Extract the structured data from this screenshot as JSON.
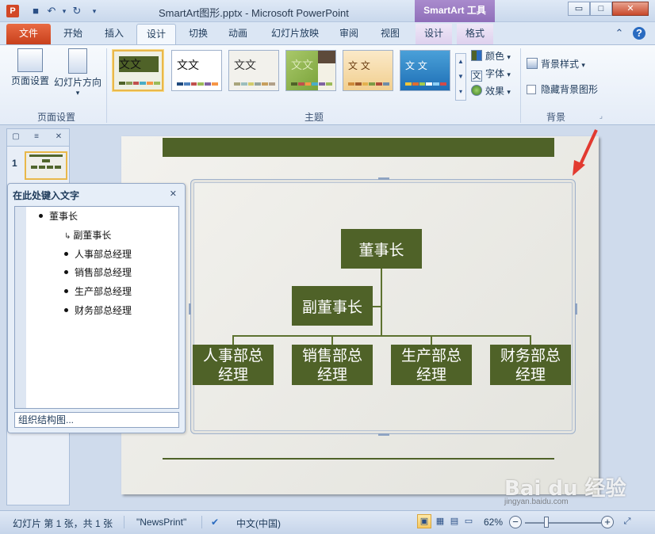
{
  "window": {
    "app_icon_letter": "P",
    "title": "SmartArt图形.pptx  -  Microsoft PowerPoint",
    "contextual_tool_title": "SmartArt 工具",
    "minimize": "▭",
    "restore": "□",
    "close": "✕",
    "qat": {
      "save": "■",
      "undo": "↶",
      "undo_dd": "▾",
      "redo": "↻",
      "customize": "▾"
    }
  },
  "tabs": {
    "file": "文件",
    "home": "开始",
    "insert": "插入",
    "design": "设计",
    "transitions": "切换",
    "animations": "动画",
    "slideshow": "幻灯片放映",
    "review": "审阅",
    "view": "视图",
    "smartart_design": "设计",
    "smartart_format": "格式",
    "help_collapse": "⌃",
    "help": "?"
  },
  "ribbon": {
    "page_setup_label": "页面设置",
    "slide_orientation_label": "幻灯片方向",
    "page_setup_group": "页面设置",
    "themes_group": "主题",
    "theme_sample_text": "文文",
    "theme_sample_text_small": "文 文",
    "colors_label": "颜色",
    "fonts_label": "字体",
    "effects_label": "效果",
    "fonts_icon": "文",
    "bg_styles_label": "背景样式",
    "hide_bg_label": "隐藏背景图形",
    "background_group": "背景",
    "dd": "▾",
    "scroll_up": "▲",
    "scroll_down": "▼",
    "scroll_more": "▾",
    "launcher": "⌟"
  },
  "thumbs": {
    "tab_slides_icon": "▢",
    "tab_outline_icon": "≡",
    "close_icon": "✕",
    "slide_number": "1"
  },
  "text_pane": {
    "title": "在此处键入文字",
    "close": "✕",
    "items": [
      {
        "text": "董事长",
        "level": 0
      },
      {
        "text": "副董事长",
        "level": 1,
        "assistant": true
      },
      {
        "text": "人事部总经理",
        "level": 1
      },
      {
        "text": "销售部总经理",
        "level": 1
      },
      {
        "text": "生产部总经理",
        "level": 1
      },
      {
        "text": "财务部总经理",
        "level": 1
      }
    ],
    "assistant_mark": "↳",
    "footer": "组织结构图..."
  },
  "org_chart": {
    "top": "董事长",
    "assistant": "副董事长",
    "departments": [
      [
        "人事部总",
        "经理"
      ],
      [
        "销售部总",
        "经理"
      ],
      [
        "生产部总",
        "经理"
      ],
      [
        "财务部总",
        "经理"
      ]
    ]
  },
  "status": {
    "slide_info": "幻灯片 第 1 张，共 1 张",
    "theme_name": "\"NewsPrint\"",
    "spellcheck_icon": "✔",
    "language": "中文(中国)",
    "zoom": "62%",
    "zoom_minus": "−",
    "zoom_plus": "+",
    "fit_icon": "⤢",
    "view_normal": "▣",
    "view_sorter": "▦",
    "view_reading": "▤",
    "view_slideshow": "▭"
  },
  "colors": {
    "accent_green": "#4f6228",
    "file_tab": "#c8401c",
    "smartart_tools": "#8d6cb8",
    "annotation_red": "#e23a30"
  },
  "watermark": {
    "text": "Bai du 经验",
    "sub": "jingyan.baidu.com"
  }
}
